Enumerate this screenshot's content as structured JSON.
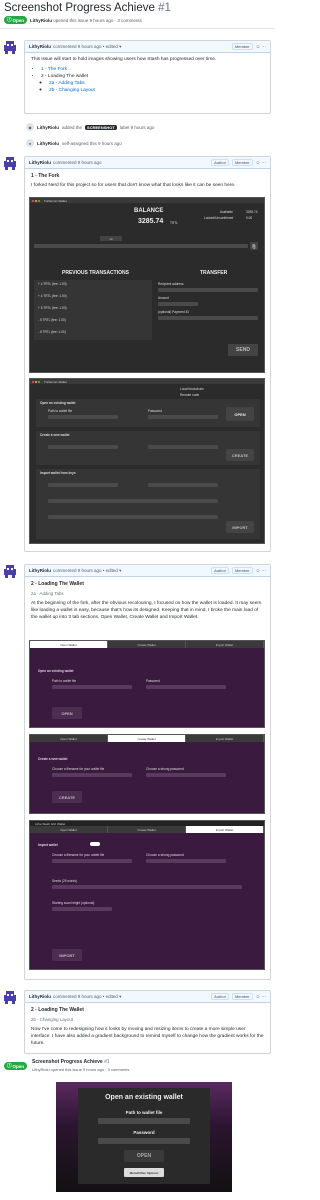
{
  "issue": {
    "title": "Screenshot Progress Achieve",
    "number": "#1",
    "status": "Open",
    "meta": "LithyRiolu opened this issue 9 hours ago · 3 comments",
    "meta_user": "LithyRiolu",
    "meta_rest": "opened this issue 9 hours ago · 3 comments"
  },
  "comment1": {
    "author": "LithyRiolu",
    "time": "commented 9 hours ago • edited ▾",
    "role": "Member",
    "intro": "This issue will start to hold images showing users how Stash has progressed over time.",
    "list1": "1 - The Fork",
    "list2": "2 - Loading The wallet",
    "list2a": "2a - Adding Tabs",
    "list2b": "2b - Changing Layout"
  },
  "timeline1": {
    "user": "LithyRiolu",
    "text_before": "added the",
    "label": "SCREENSHOT",
    "text_after": "label 9 hours ago"
  },
  "timeline2": {
    "user": "LithyRiolu",
    "text": "self-assigned this 9 hours ago"
  },
  "comment2": {
    "author": "LithyRiolu",
    "time": "commented 9 hours ago",
    "role1": "Author",
    "role2": "Member",
    "heading": "1 - The Fork",
    "body": "I forked Nerd for this project so for users that don't know what that looks like it can be seen here.",
    "app": {
      "window_title": "TurtleCoin Wallet",
      "balance_label": "BALANCE",
      "balance_value": "3285.74",
      "currency": "TRTL",
      "available": "Available",
      "available_value": "3285.74",
      "locked": "Locked/Unconfirmed",
      "locked_value": "0.00",
      "prev_tx": "PREVIOUS TRANSACTIONS",
      "transfer": "TRANSFER",
      "send": "SEND",
      "tx": [
        "+ 4 TRTL (fee: 1.00)",
        "+ 4 TRTL (fee: 1.00)",
        "+ 5 TRTL (fee: 1.00)",
        "- 5 TRTL (fee: 1.00)",
        "- 6 TRTL (fee: 1.00)"
      ],
      "recipient": "Recipient address",
      "amount": "Amount",
      "payment_id": "(optional) Payment ID",
      "open_existing": "Open an existing wallet",
      "path_label": "Path to wallet file",
      "password_label": "Password",
      "open_btn": "OPEN",
      "create_new": "Create a new wallet",
      "create_btn": "CREATE",
      "import_keys": "Import wallet from keys",
      "import_btn": "IMPORT",
      "local_daemon": "Local blockchain",
      "remote_daemon": "Remote node"
    }
  },
  "comment3": {
    "author": "LithyRiolu",
    "time": "commented 9 hours ago • edited ▾",
    "role1": "Author",
    "role2": "Member",
    "heading": "2 - Loading The Wallet",
    "subheading": "2a - Adding Tabs",
    "body": "At the beginning of the fork, after the obvious recolouring, I focused on how the wallet is loaded. It may seem like loading a wallet is easy, because that's how its designed. Keeping that in mind, I broke the main load of the wallet up into 3 tab sections, Open Wallet, Create Wallet and Import Wallet.",
    "tabs": [
      "Open Wallet",
      "Create Wallet",
      "Import Wallet"
    ],
    "app_title": "Lithe Stash GUI Wallet",
    "open_existing": "Open an existing wallet",
    "create_new": "Create a new wallet",
    "import_wallet": "Import wallet",
    "path_label": "Path to wallet file",
    "password_label": "Password",
    "filename_label": "Choose a filename for your wallet file",
    "choose_password": "Choose a strong password",
    "seed_label": "Seeds (25 words)",
    "height_label": "Starting scan height (optional)",
    "open_btn": "OPEN",
    "create_btn": "CREATE",
    "import_btn": "IMPORT"
  },
  "comment4": {
    "author": "LithyRiolu",
    "time": "commented 9 hours ago • edited ▾",
    "role1": "Author",
    "role2": "Member",
    "heading": "2 - Loading The Wallet",
    "subheading": "2b - Changing Layout",
    "body": "Now I've come to redesigning how it looks by moving and resizing items to create a more simple user interface. I have also added a gradient background to remind myself to change how the gradient works for the future."
  },
  "mini_issue": {
    "title": "Screenshot Progress Achieve",
    "number": "#1",
    "meta": "LithyRiolu opened this issue 9 hours ago · 3 comments"
  },
  "final_app": {
    "heading": "Open an existing wallet",
    "path_label": "Path to wallet file",
    "password_label": "Password",
    "open_btn": "OPEN",
    "other_btn": "Menu/Other Options"
  },
  "colors": {
    "open_green": "#28a745",
    "link_blue": "#0366d6",
    "app_dark": "#2b2b2b",
    "purple": "#3b1a3f"
  }
}
